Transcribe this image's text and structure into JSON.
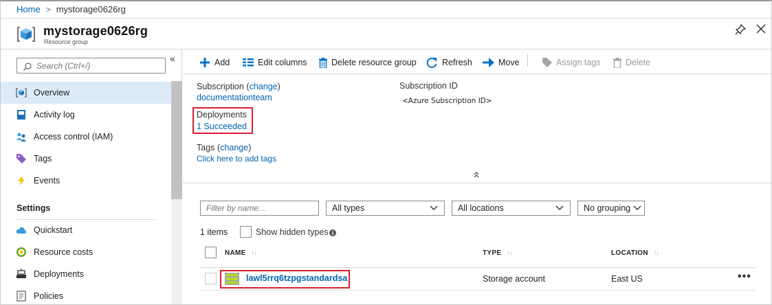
{
  "breadcrumb": {
    "home": "Home",
    "current": "mystorage0626rg"
  },
  "header": {
    "title": "mystorage0626rg",
    "subtitle": "Resource group"
  },
  "sidebar": {
    "collapse_glyph": "«",
    "search_placeholder": "Search (Ctrl+/)",
    "items": [
      {
        "label": "Overview",
        "icon": "resource-group-icon",
        "active": true
      },
      {
        "label": "Activity log",
        "icon": "activity-log-icon"
      },
      {
        "label": "Access control (IAM)",
        "icon": "iam-icon"
      },
      {
        "label": "Tags",
        "icon": "tag-icon"
      },
      {
        "label": "Events",
        "icon": "lightning-icon"
      }
    ],
    "settings_label": "Settings",
    "settings_items": [
      {
        "label": "Quickstart",
        "icon": "cloud-icon"
      },
      {
        "label": "Resource costs",
        "icon": "cost-icon"
      },
      {
        "label": "Deployments",
        "icon": "deployments-icon"
      },
      {
        "label": "Policies",
        "icon": "policies-icon"
      }
    ]
  },
  "toolbar": {
    "add": "Add",
    "edit_columns": "Edit columns",
    "delete_rg": "Delete resource group",
    "refresh": "Refresh",
    "move": "Move",
    "assign_tags": "Assign tags",
    "delete": "Delete"
  },
  "essentials": {
    "subscription_label": "Subscription",
    "change_open": "(",
    "change": "change",
    "change_close": ")",
    "subscription_value": "documentationteam",
    "subscription_id_label": "Subscription ID",
    "subscription_id_value": "<Azure Subscription ID>",
    "deployments_label": "Deployments",
    "deployments_value": "1 Succeeded",
    "tags_label": "Tags",
    "tags_value": "Click here to add tags",
    "collapse_glyph": "⌃⌃"
  },
  "filters": {
    "name_placeholder": "Filter by name...",
    "types": "All types",
    "locations": "All locations",
    "grouping": "No grouping"
  },
  "list": {
    "count": "1 items",
    "show_hidden": "Show hidden types",
    "columns": {
      "name": "NAME",
      "type": "TYPE",
      "location": "LOCATION"
    },
    "sort_glyph": "↑↓",
    "rows": [
      {
        "name": "lawl5rrq6tzpgstandardsa",
        "type": "Storage account",
        "location": "East US"
      }
    ],
    "more": "•••"
  },
  "colors": {
    "link": "#0063b1",
    "accent": "#0072c6",
    "highlight_box": "#d81e2e",
    "active_nav": "#dcebf7"
  }
}
